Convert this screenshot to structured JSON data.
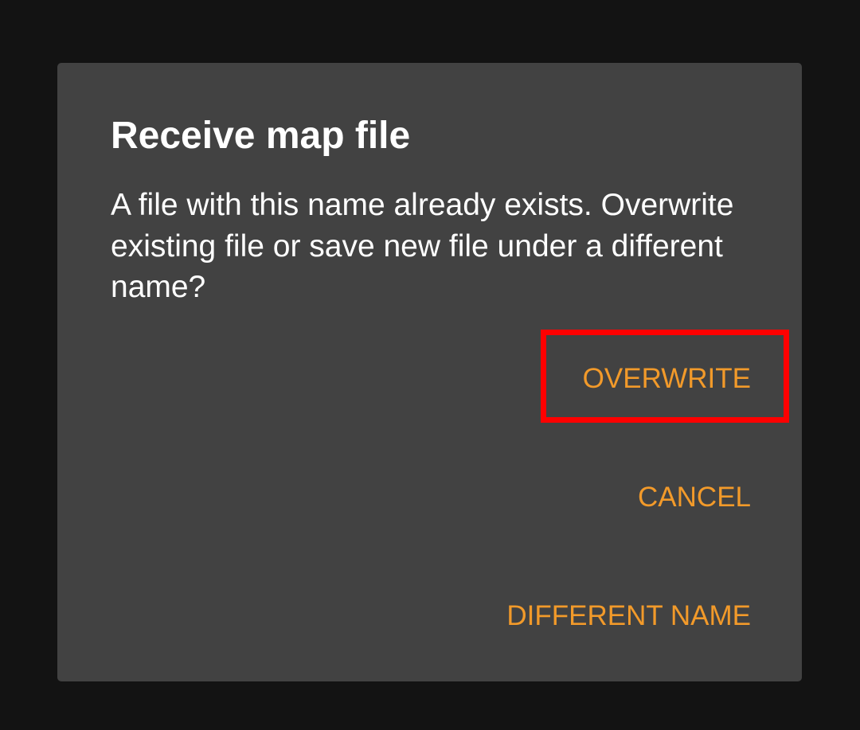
{
  "dialog": {
    "title": "Receive map file",
    "message": "A file with this name already exists. Overwrite existing file or save new file under a different name?",
    "actions": {
      "overwrite": "OVERWRITE",
      "cancel": "CANCEL",
      "different_name": "DIFFERENT NAME"
    }
  },
  "colors": {
    "background": "#131313",
    "dialog_surface": "#424242",
    "accent": "#f29a2a",
    "highlight": "#ff0000"
  }
}
